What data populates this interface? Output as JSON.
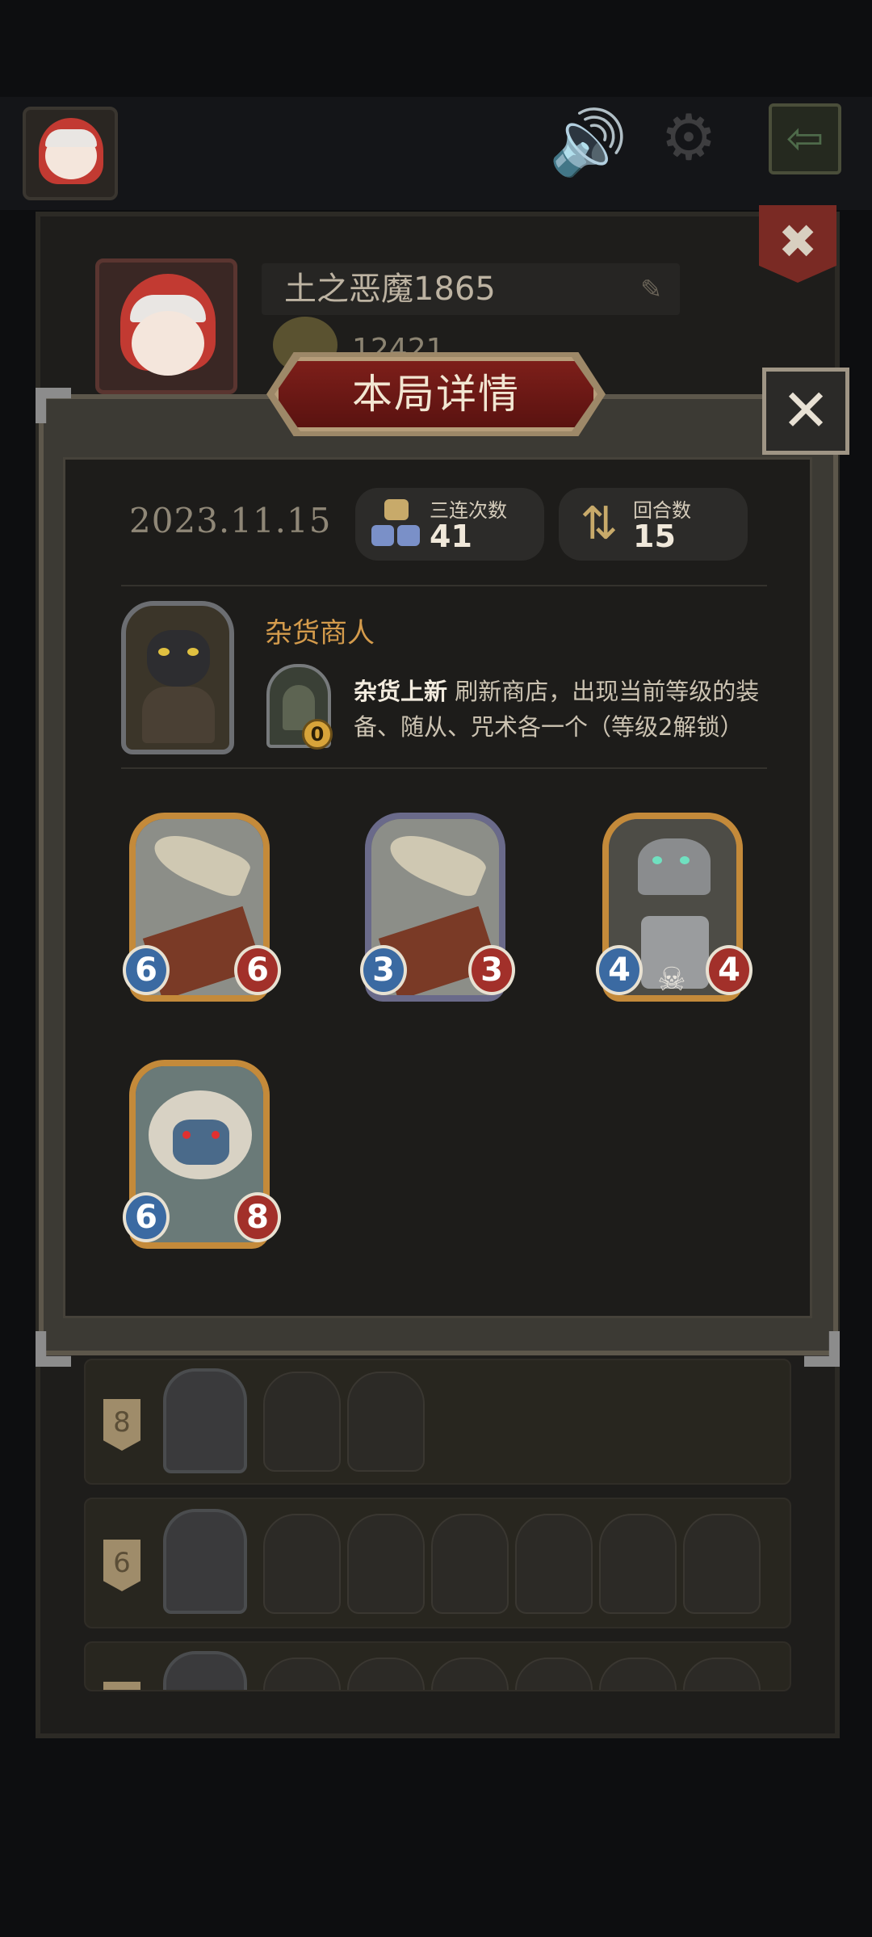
{
  "player": {
    "name": "土之恶魔1865",
    "score": "12421"
  },
  "modal": {
    "title": "本局详情",
    "date": "2023.11.15",
    "stats": [
      {
        "label": "三连次数",
        "value": "41",
        "icon": "triple-icon"
      },
      {
        "label": "回合数",
        "value": "15",
        "icon": "rounds-icon"
      }
    ],
    "hero": {
      "name": "杂货商人",
      "skill_name": "杂货上新",
      "skill_desc": " 刷新商店，出现当前等级的装备、随从、咒术各一个（等级2解锁）",
      "skill_cost": "0"
    },
    "cards": [
      {
        "attack": "6",
        "health": "6",
        "frame": "gold",
        "art": "airship"
      },
      {
        "attack": "3",
        "health": "3",
        "frame": "silver",
        "art": "airship"
      },
      {
        "attack": "4",
        "health": "4",
        "frame": "gold",
        "art": "robot"
      },
      {
        "attack": "6",
        "health": "8",
        "frame": "gold",
        "art": "dragon"
      }
    ]
  },
  "history": [
    {
      "rank": "8",
      "minion_count": 2
    },
    {
      "rank": "6",
      "minion_count": 6
    },
    {
      "rank": "",
      "minion_count": 6
    }
  ],
  "colors": {
    "gold_frame": "#c48a3a",
    "silver_frame": "#6a6a8a",
    "attack": "#3b6aa2",
    "health": "#a2302a",
    "title_red": "#7d1f1a"
  }
}
